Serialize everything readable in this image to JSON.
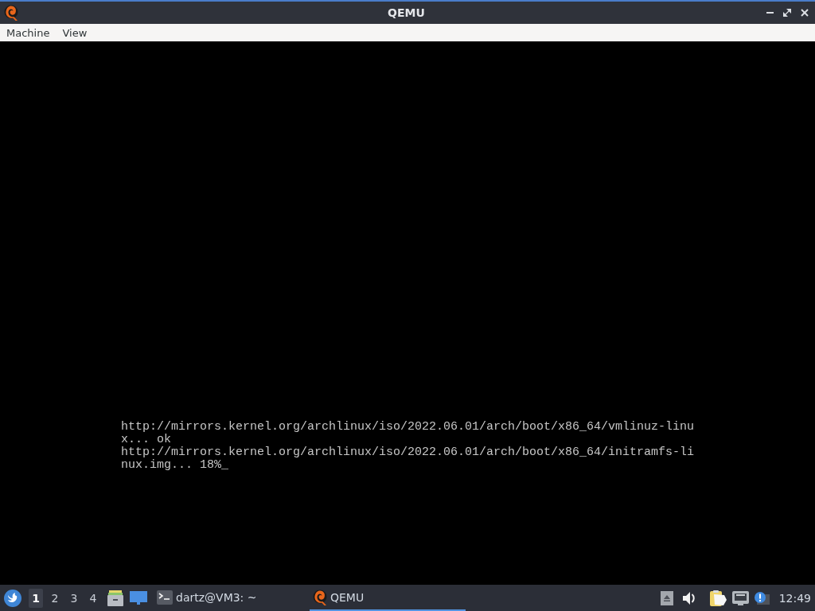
{
  "window": {
    "title": "QEMU"
  },
  "menu": [
    {
      "label": "Machine"
    },
    {
      "label": "View"
    }
  ],
  "console": {
    "lines": [
      "http://mirrors.kernel.org/archlinux/iso/2022.06.01/arch/boot/x86_64/vmlinuz-linu",
      "x... ok",
      "http://mirrors.kernel.org/archlinux/iso/2022.06.01/arch/boot/x86_64/initramfs-li",
      "nux.img... 18%_"
    ]
  },
  "taskbar": {
    "workspaces": [
      {
        "label": "1",
        "selected": true
      },
      {
        "label": "2",
        "selected": false
      },
      {
        "label": "3",
        "selected": false
      },
      {
        "label": "4",
        "selected": false
      }
    ],
    "tasks": [
      {
        "kind": "terminal",
        "label": "dartz@VM3: ~",
        "selected": false
      },
      {
        "kind": "qemu",
        "label": "QEMU",
        "selected": true
      }
    ],
    "clock": "12:49"
  }
}
